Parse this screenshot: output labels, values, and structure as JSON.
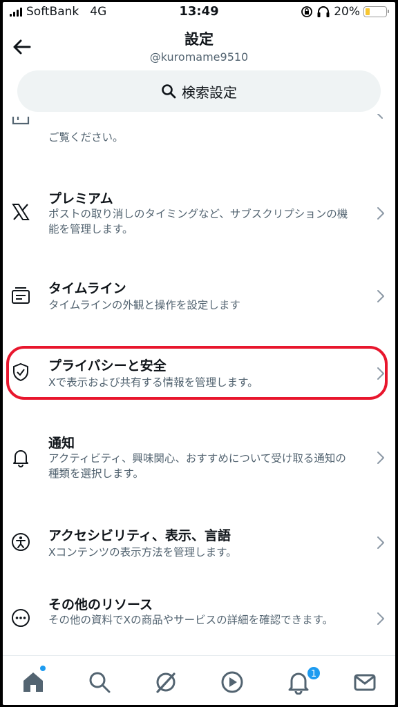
{
  "status_bar": {
    "carrier": "SoftBank",
    "network": "4G",
    "time": "13:49",
    "battery": "20%"
  },
  "header": {
    "title": "設定",
    "handle": "@kuromame9510"
  },
  "search": {
    "label": "検索設定"
  },
  "settings": {
    "partial_desc": "ご覧ください。",
    "items": [
      {
        "title": "プレミアム",
        "desc": "ポストの取り消しのタイミングなど、サブスクリプションの機能を管理します。",
        "icon": "x-logo-icon"
      },
      {
        "title": "タイムライン",
        "desc": "タイムラインの外観と操作を設定します",
        "icon": "timeline-icon"
      },
      {
        "title": "プライバシーと安全",
        "desc": "Xで表示および共有する情報を管理します。",
        "icon": "shield-icon"
      },
      {
        "title": "通知",
        "desc": "アクティビティ、興味関心、おすすめについて受け取る通知の種類を選択します。",
        "icon": "bell-icon"
      },
      {
        "title": "アクセシビリティ、表示、言語",
        "desc": "Xコンテンツの表示方法を管理します。",
        "icon": "accessibility-icon"
      },
      {
        "title": "その他のリソース",
        "desc": "その他の資料でXの商品やサービスの詳細を確認できます。",
        "icon": "more-icon"
      }
    ]
  },
  "tabbar": {
    "notification_count": "1",
    "icons": [
      "home-icon",
      "search-icon",
      "grok-icon",
      "video-icon",
      "bell-icon",
      "mail-icon"
    ]
  },
  "colors": {
    "highlight": "#e8162d",
    "accent": "#1d9bf0"
  }
}
